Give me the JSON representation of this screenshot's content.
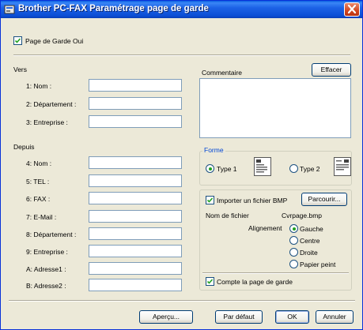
{
  "window": {
    "title": "Brother PC-FAX Paramétrage page de garde"
  },
  "cover_page": {
    "label": "Page de Garde Oui",
    "checked": true
  },
  "to": {
    "header": "Vers",
    "fields": [
      {
        "label": "1: Nom :",
        "value": ""
      },
      {
        "label": "2: Département :",
        "value": ""
      },
      {
        "label": "3: Entreprise :",
        "value": ""
      }
    ]
  },
  "from": {
    "header": "Depuis",
    "fields": [
      {
        "label": "4: Nom :",
        "value": ""
      },
      {
        "label": "5: TEL :",
        "value": ""
      },
      {
        "label": "6: FAX :",
        "value": ""
      },
      {
        "label": "7: E-Mail :",
        "value": ""
      },
      {
        "label": "8: Département :",
        "value": ""
      },
      {
        "label": "9: Entreprise :",
        "value": ""
      },
      {
        "label": "A: Adresse1 :",
        "value": ""
      },
      {
        "label": "B: Adresse2 :",
        "value": ""
      }
    ]
  },
  "comment": {
    "label": "Commentaire",
    "clear_button": "Effacer",
    "value": ""
  },
  "form": {
    "legend": "Forme",
    "type1": {
      "label": "Type 1",
      "selected": true
    },
    "type2": {
      "label": "Type 2",
      "selected": false
    }
  },
  "bmp": {
    "import_label": "Importer un fichier BMP",
    "import_checked": true,
    "browse_button": "Parcourir...",
    "filename_label": "Nom de fichier",
    "filename_value": "Cvrpage.bmp",
    "alignment_label": "Alignement",
    "alignment_options": [
      "Gauche",
      "Centre",
      "Droite",
      "Papier peint"
    ],
    "alignment_selected": "Gauche"
  },
  "count_cover": {
    "label": "Compte la page de garde",
    "checked": true
  },
  "buttons": {
    "preview": "Aperçu...",
    "default": "Par défaut",
    "ok": "OK",
    "cancel": "Annuler"
  },
  "colors": {
    "title_bar": "#0c4fd6",
    "dialog_bg": "#ece9d8",
    "legend_text": "#0046d5",
    "check_mark": "#21a121",
    "close_button": "#d2461f"
  }
}
